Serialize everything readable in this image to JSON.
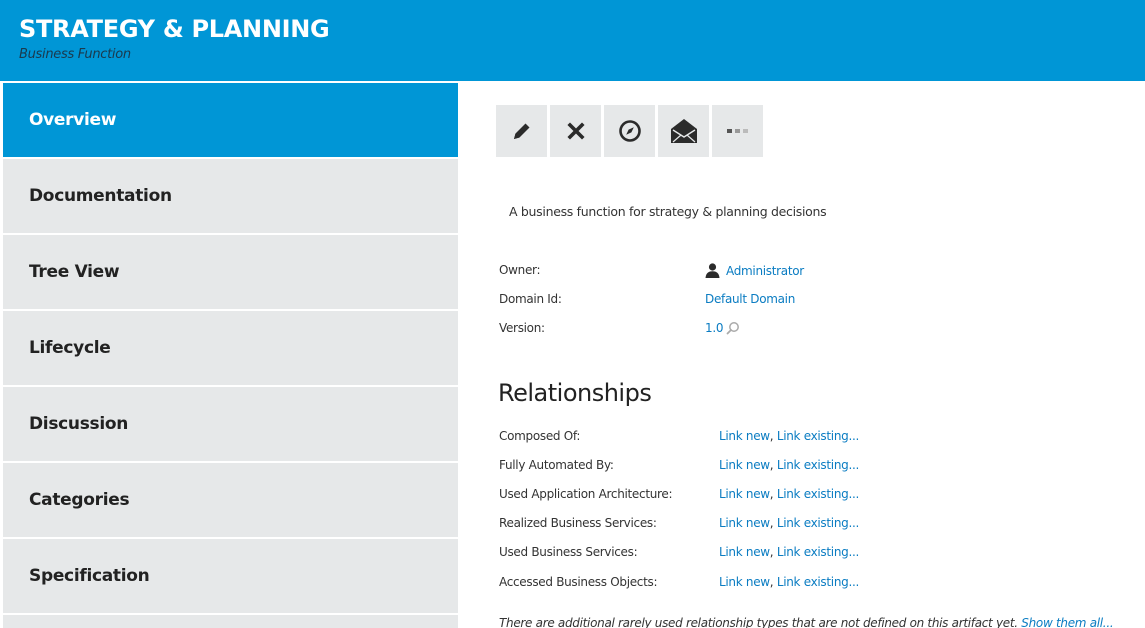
{
  "header": {
    "title": "STRATEGY & PLANNING",
    "subtitle": "Business Function"
  },
  "sidebar": {
    "items": [
      {
        "label": "Overview",
        "active": true
      },
      {
        "label": "Documentation"
      },
      {
        "label": "Tree View"
      },
      {
        "label": "Lifecycle"
      },
      {
        "label": "Discussion"
      },
      {
        "label": "Categories"
      },
      {
        "label": "Specification"
      }
    ]
  },
  "toolbar": {
    "buttons": [
      "edit-icon",
      "delete-icon",
      "compass-icon",
      "mail-icon",
      "more-icon"
    ]
  },
  "description": "A business function for strategy & planning decisions",
  "properties": {
    "owner_label": "Owner:",
    "owner_value": "Administrator",
    "domain_label": "Domain Id:",
    "domain_value": "Default Domain",
    "version_label": "Version:",
    "version_value": "1.0"
  },
  "relationships": {
    "title": "Relationships",
    "link_new": "Link new",
    "separator": ", ",
    "link_existing": "Link existing...",
    "rows": [
      "Composed Of:",
      "Fully Automated By:",
      "Used Application Architecture:",
      "Realized Business Services:",
      "Used Business Services:",
      "Accessed Business Objects:"
    ],
    "note_text": "There are additional rarely used relationship types that are not defined on this artifact yet. ",
    "note_link": "Show them all..."
  },
  "colors": {
    "brand": "#0096d6",
    "link": "#0a7cc2",
    "nav_bg": "#e6e8e9"
  }
}
